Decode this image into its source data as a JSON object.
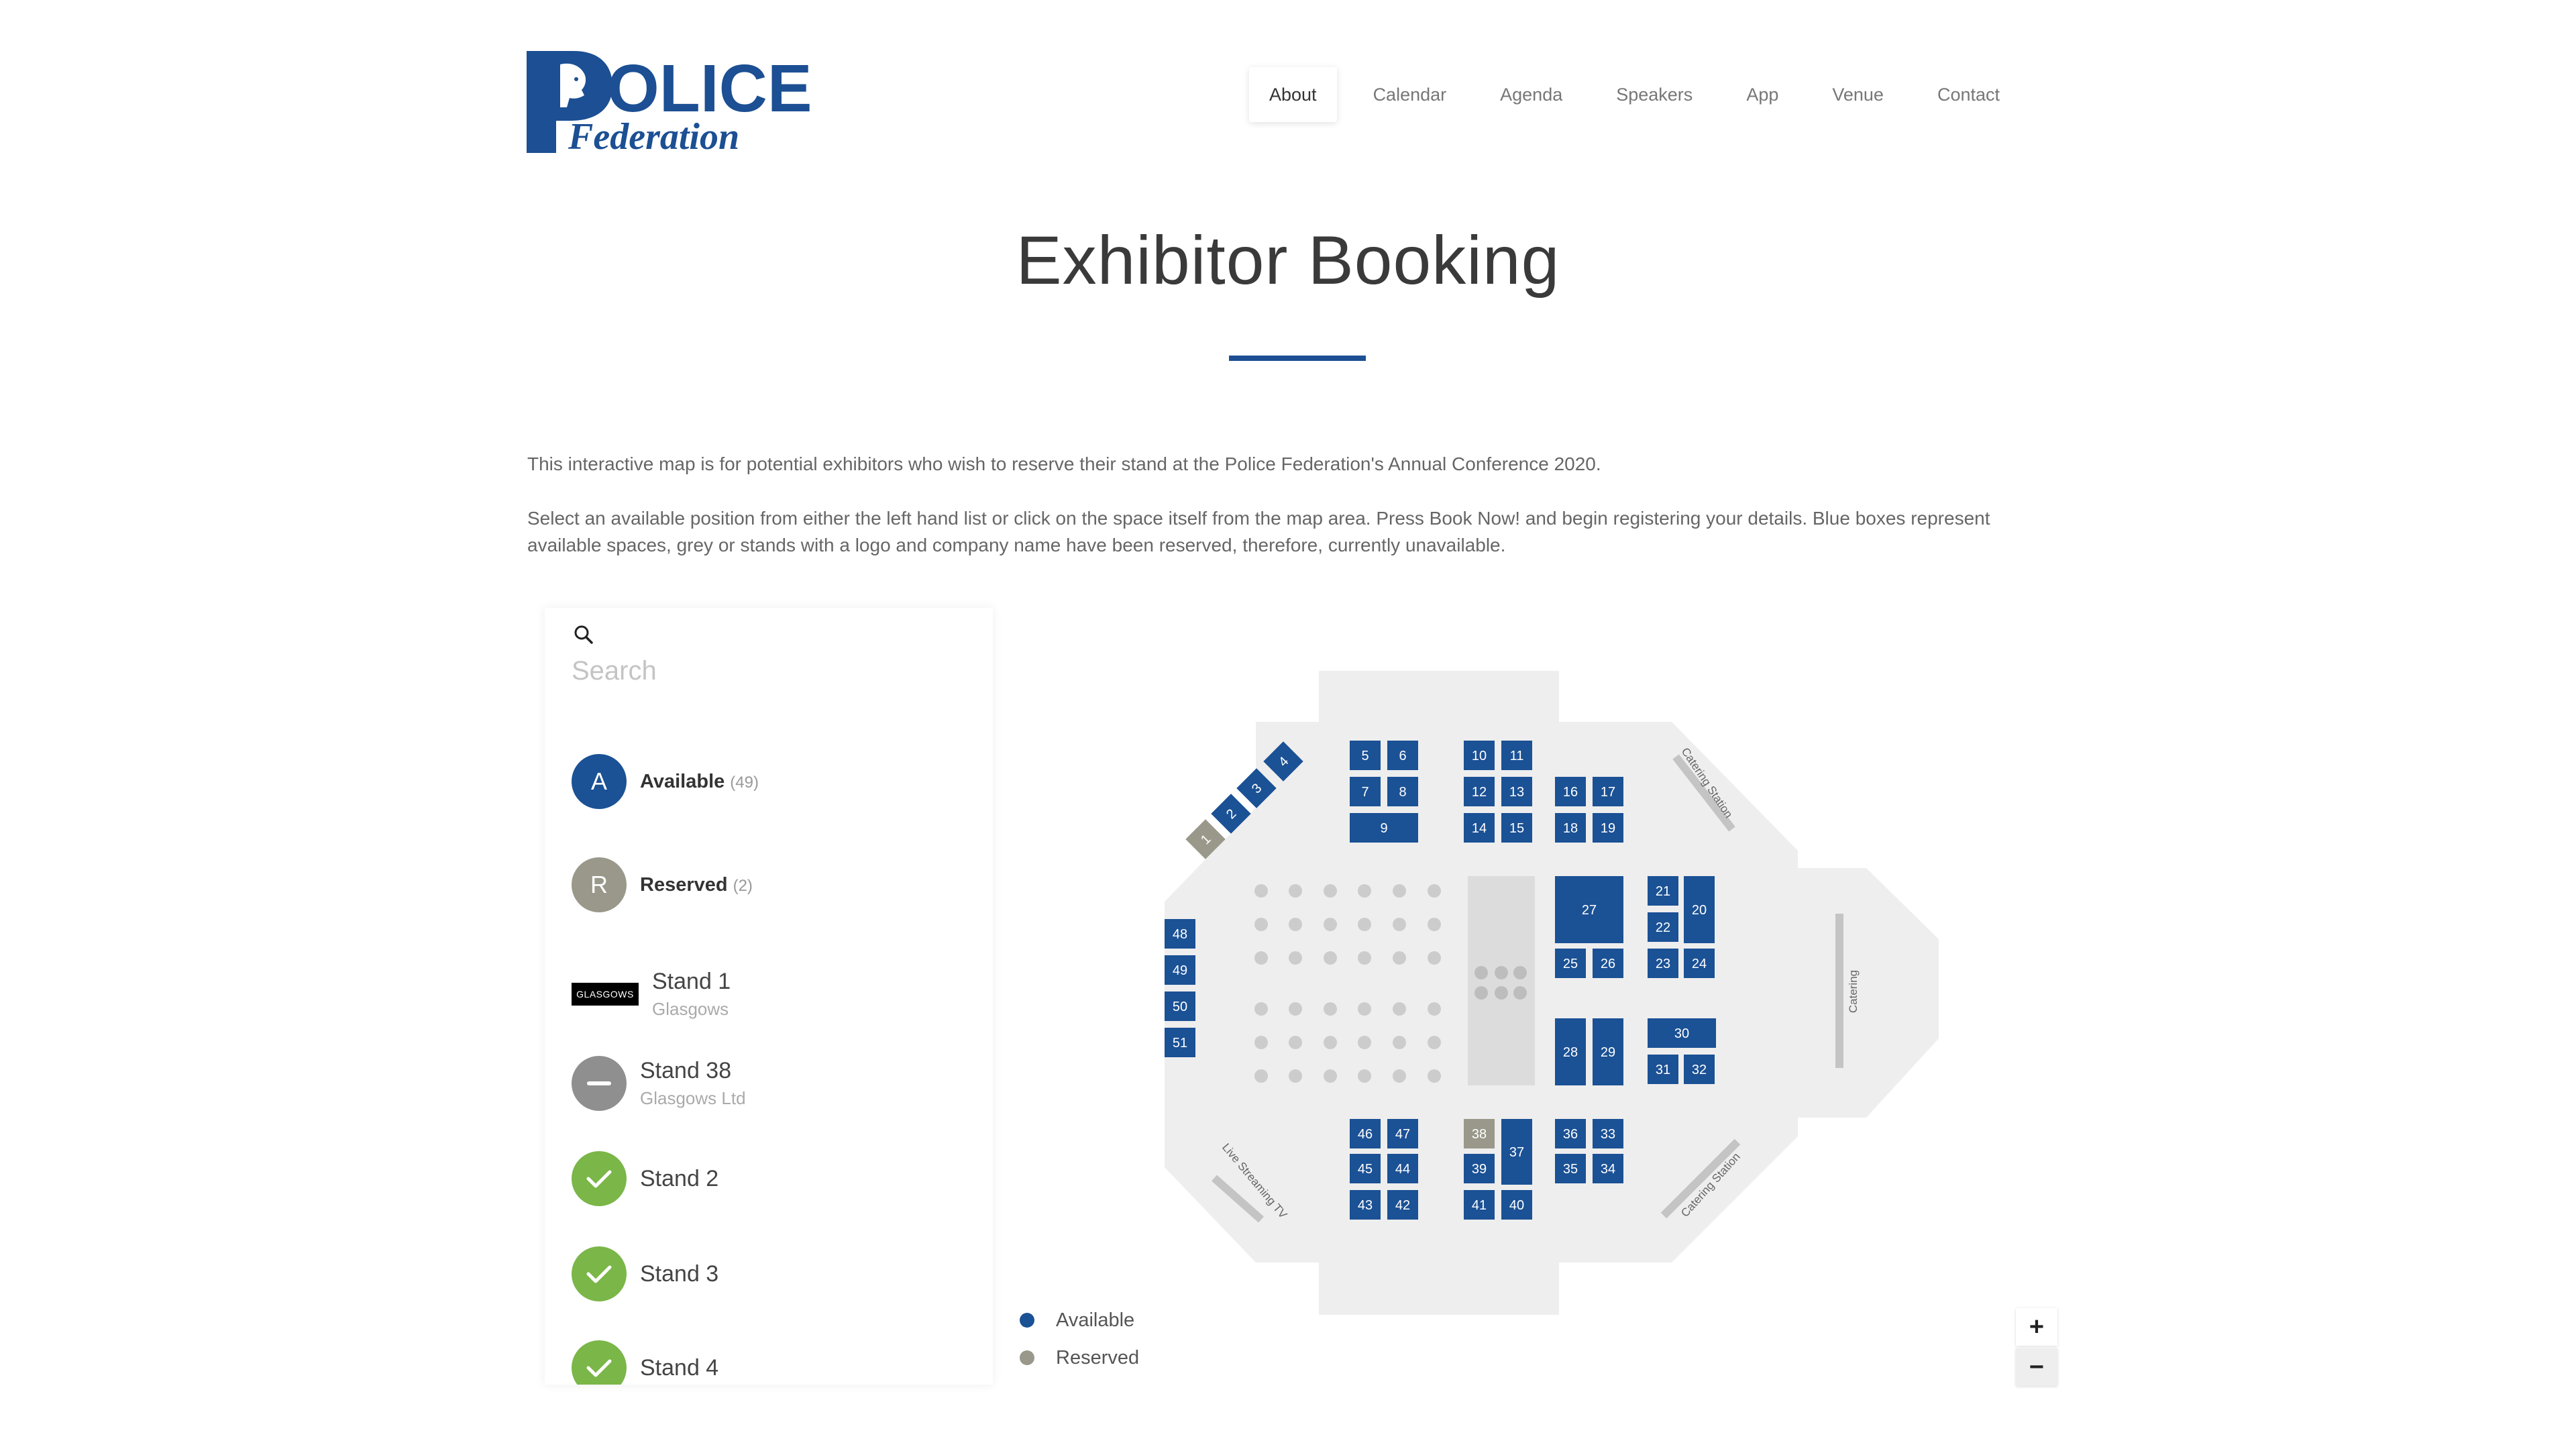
{
  "brand": {
    "logo_word_top": "OLICE",
    "logo_word_bottom": "Federation",
    "logo_color": "#1c4f93"
  },
  "nav": {
    "items": [
      {
        "label": "About",
        "active": true
      },
      {
        "label": "Calendar"
      },
      {
        "label": "Agenda"
      },
      {
        "label": "Speakers"
      },
      {
        "label": "App"
      },
      {
        "label": "Venue"
      },
      {
        "label": "Contact"
      }
    ]
  },
  "page": {
    "title": "Exhibitor Booking",
    "intro_1": "This interactive map is for potential exhibitors who wish to reserve their stand at the Police Federation's Annual Conference 2020.",
    "intro_2": "Select an available position from either the left hand list or click on the space itself from the map area. Press Book Now! and begin registering your details. Blue boxes represent available spaces, grey or stands with a logo and company name have been reserved, therefore, currently unavailable."
  },
  "sidebar": {
    "search": {
      "icon": "search-icon",
      "placeholder": "Search",
      "value": ""
    },
    "groups": [
      {
        "letter": "A",
        "label": "Available",
        "count": "(49)"
      },
      {
        "letter": "R",
        "label": "Reserved",
        "count": "(2)"
      }
    ],
    "stands": [
      {
        "name": "Stand 1",
        "company": "Glasgows",
        "logo_text": "GLASGOWS",
        "status": "logo"
      },
      {
        "name": "Stand 38",
        "company": "Glasgows Ltd",
        "status": "reserved"
      },
      {
        "name": "Stand 2",
        "status": "available"
      },
      {
        "name": "Stand 3",
        "status": "available"
      },
      {
        "name": "Stand 4",
        "status": "available"
      }
    ]
  },
  "map": {
    "colors": {
      "available": "#1b5195",
      "reserved": "#99988a",
      "floor": "#eeeeee",
      "feature": "#dcdcdc"
    },
    "labels": {
      "catering_station": "Catering Station",
      "catering": "Catering",
      "live_streaming": "Live Streaming TV"
    },
    "stands": [
      "1",
      "2",
      "3",
      "4",
      "5",
      "6",
      "7",
      "8",
      "9",
      "10",
      "11",
      "12",
      "13",
      "14",
      "15",
      "16",
      "17",
      "18",
      "19",
      "20",
      "21",
      "22",
      "23",
      "24",
      "25",
      "26",
      "27",
      "28",
      "29",
      "30",
      "31",
      "32",
      "33",
      "34",
      "35",
      "36",
      "37",
      "38",
      "39",
      "40",
      "41",
      "42",
      "43",
      "44",
      "45",
      "46",
      "47",
      "48",
      "49",
      "50",
      "51"
    ],
    "reserved": [
      "1",
      "38"
    ]
  },
  "legend": [
    {
      "label": "Available",
      "color": "#1b5195"
    },
    {
      "label": "Reserved",
      "color": "#99988a"
    }
  ],
  "zoom": {
    "in_label": "+",
    "out_label": "−"
  }
}
